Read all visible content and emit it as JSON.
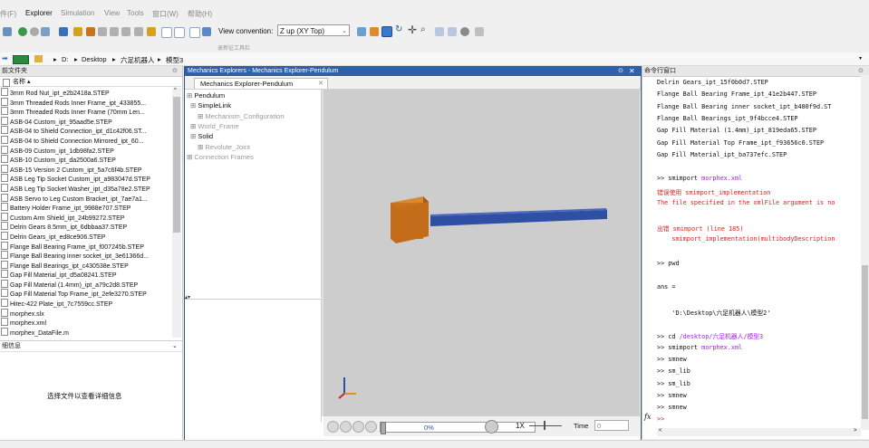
{
  "menu": [
    "件(F)",
    "Explorer",
    "Simulation",
    "View",
    "Tools",
    "窗口(W)",
    "帮助(H)"
  ],
  "toolbar": {
    "view_convention_label": "View convention:",
    "view_convention_value": "Z up (XY Top)",
    "caption": "录新征工具栏"
  },
  "address": {
    "crumbs": [
      "D:",
      "Desktop",
      "六足机器人",
      "模型3"
    ]
  },
  "current_folder": {
    "title": "前文件夹",
    "column_header": "名称 ▴"
  },
  "files": [
    "3mm Rod Nut_ipt_e2b2418a.STEP",
    "3mm Threaded Rods Inner Frame_ipt_433855...",
    "3mm Threaded Rods Inner Frame (70mm Len...",
    "ASB-04 Custom_ipt_95aad5e.STEP",
    "ASB-04 to Shield Connection_ipt_d1c42f06.ST...",
    "ASB-04 to Shield Connection Mirrored_ipt_60...",
    "ASB-09 Custom_ipt_1db98fa2.STEP",
    "ASB-10 Custom_ipt_da2500a6.STEP",
    "ASB-15 Version 2 Custom_ipt_5a7c6f4b.STEP",
    "ASB Leg Tip Socket Custom_ipt_a983047d.STEP",
    "ASB Leg Tip Socket Washer_ipt_d35a78e2.STEP",
    "ASB Servo to Leg Custom Bracket_ipt_7ae7a1...",
    "Battery Holder Frame_ipt_9988e707.STEP",
    "Custom Arm Shield_ipt_24b99272.STEP",
    "Delrin Gears 8.5mm_ipt_6dbbaa37.STEP",
    "Delrin Gears_ipt_ed8ce906.STEP",
    "Flange Ball Bearing Frame_ipt_f007245b.STEP",
    "Flange Ball Bearing inner socket_ipt_3e61366d...",
    "Flange Ball Bearings_ipt_c430538e.STEP",
    "Gap Fill Material_ipt_d5a08241.STEP",
    "Gap Fill Material (1.4mm)_ipt_a79c2d8.STEP",
    "Gap Fill Material Top Frame_ipt_2efe3270.STEP",
    "Hitec-422 Plate_ipt_7c7559cc.STEP",
    "morphex.slx",
    "morphex.xml",
    "morphex_DataFile.m"
  ],
  "details": {
    "title": "细信息",
    "empty_message": "选择文件以查看详细信息"
  },
  "mechanics": {
    "window_title": "Mechanics Explorers - Mechanics Explorer-Pendulum",
    "tab_label": "Mechanics Explorer-Pendulum",
    "tree": [
      {
        "label": "Pendulum",
        "dim": false
      },
      {
        "label": "SimpleLink",
        "dim": false
      },
      {
        "label": "Mechanism_Configuration",
        "dim": true
      },
      {
        "label": "World_Frame",
        "dim": true
      },
      {
        "label": "Solid",
        "dim": false
      },
      {
        "label": "Revolute_Joint",
        "dim": true
      },
      {
        "label": "Connection Frames",
        "dim": true
      }
    ],
    "progress_text": "0%",
    "progress": 0.0,
    "speed": "1X",
    "time_label": "Time",
    "time_value": "0",
    "colors": {
      "block": "#c9731d",
      "rod": "#2e4fa3",
      "viewport": "#cdcdcd"
    }
  },
  "command_window": {
    "title": "命令行窗口",
    "lines": [
      {
        "t": "Delrin Gears_ipt_15f0b0d7.STEP",
        "c": ""
      },
      {
        "t": "Flange Ball Bearing Frame_ipt_41e2b447.STEP",
        "c": ""
      },
      {
        "t": "Flange Ball Bearing inner socket_ipt_b480f9d.ST",
        "c": ""
      },
      {
        "t": "Flange Ball Bearings_ipt_9f4bcce4.STEP",
        "c": ""
      },
      {
        "t": "Gap Fill Material (1.4mm)_ipt_819eda65.STEP",
        "c": ""
      },
      {
        "t": "Gap Fill Material Top Frame_ipt_f93656c0.STEP",
        "c": ""
      },
      {
        "t": "Gap Fill Material_ipt_ba737efc.STEP",
        "c": ""
      },
      {
        "t": "",
        "c": ""
      },
      {
        "t": ">> smimport morphex.xml",
        "c": "cmd"
      },
      {
        "t": "错误使用 smimport_implementation",
        "c": "red"
      },
      {
        "t": "The file specified in the xmlFile argument is no",
        "c": "red"
      },
      {
        "t": "",
        "c": ""
      },
      {
        "t": "出错 smimport (line 185)",
        "c": "red"
      },
      {
        "t": "    smimport_implementation(multibodyDescription",
        "c": "red"
      },
      {
        "t": "",
        "c": ""
      },
      {
        "t": ">> pwd",
        "c": ""
      },
      {
        "t": "",
        "c": ""
      },
      {
        "t": "ans =",
        "c": ""
      },
      {
        "t": "",
        "c": ""
      },
      {
        "t": "    'D:\\Desktop\\六足机器人\\模型2'",
        "c": ""
      },
      {
        "t": "",
        "c": ""
      },
      {
        "t": ">> cd /desktop/六足机器人/模型3",
        "c": "cmd"
      },
      {
        "t": ">> smimport morphex.xml",
        "c": "cmd"
      },
      {
        "t": ">> smnew",
        "c": ""
      },
      {
        "t": ">> sm_lib",
        "c": ""
      },
      {
        "t": ">> sm_lib",
        "c": ""
      },
      {
        "t": ">> smnew",
        "c": ""
      },
      {
        "t": ">> smnew",
        "c": ""
      },
      {
        "t": ">>",
        "c": "prompt"
      }
    ],
    "fx_label": "fx"
  }
}
